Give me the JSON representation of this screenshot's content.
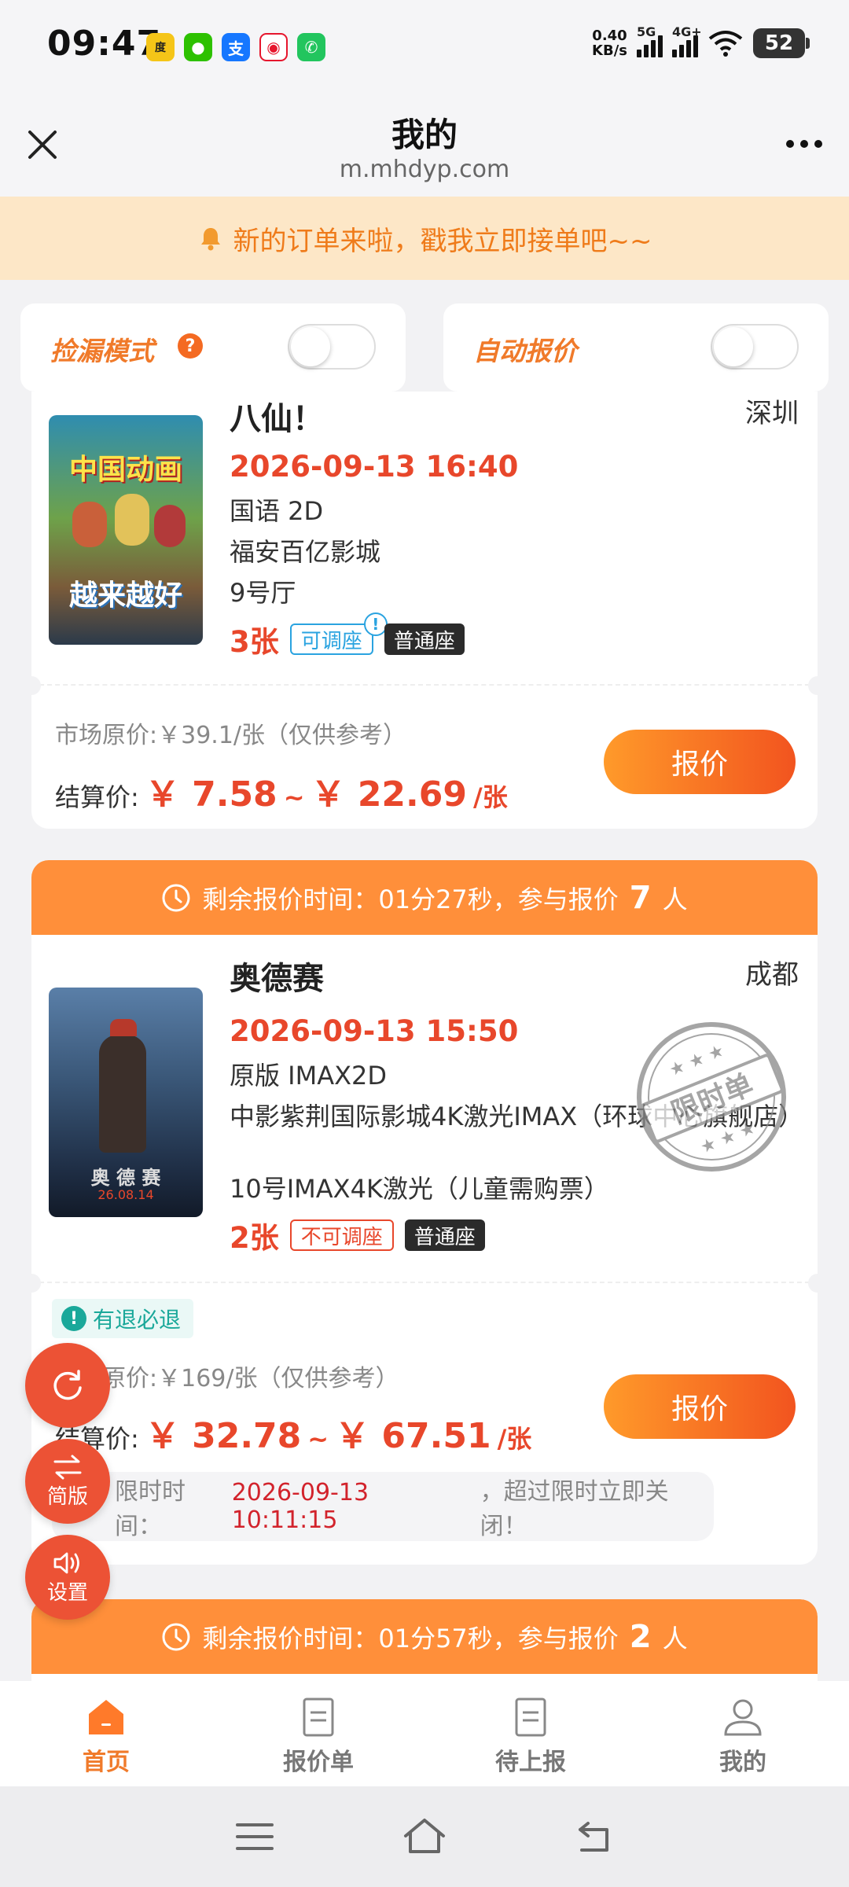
{
  "status_bar": {
    "time": "09:47",
    "net_speed_value": "0.40",
    "net_speed_unit": "KB/s",
    "signal1_label": "5G",
    "signal2_label": "4G+",
    "battery": "52",
    "app_icons": [
      "baidu-app-icon",
      "wechat-icon",
      "alipay-icon",
      "weibo-icon",
      "phone-call-icon"
    ]
  },
  "header": {
    "title": "我的",
    "url": "m.mhdyp.com"
  },
  "notice": {
    "text": "新的订单来啦，戳我立即接单吧~~"
  },
  "toggles": [
    {
      "label": "捡漏模式",
      "on": false
    },
    {
      "label": "自动报价",
      "on": false
    }
  ],
  "orders": [
    {
      "movie": "八仙！",
      "city": "深圳",
      "datetime": "2026-09-13 16:40",
      "format": "国语 2D",
      "cinema": "福安百亿影城",
      "hall": "9号厅",
      "count": "3张",
      "tag1": "可调座",
      "tag2": "普通座",
      "market_price": "市场原价:￥39.1/张（仅供参考）",
      "settle_label": "结算价:",
      "price_low": "￥ 7.58",
      "price_sep": "~",
      "price_high": "￥ 22.69",
      "price_unit": "/张",
      "quote_btn": "报价",
      "poster_text1": "中国动画",
      "poster_text2": "越来越好"
    },
    {
      "countdown_prefix": "剩余报价时间：01分27秒，参与报价",
      "countdown_count": "7",
      "countdown_suffix": "人",
      "movie": "奥德赛",
      "city": "成都",
      "datetime": "2026-09-13 15:50",
      "format": "原版 IMAX2D",
      "cinema": "中影紫荆国际影城4K激光IMAX（环球中心旗舰店）",
      "hall": "10号IMAX4K激光（儿童需购票）",
      "count": "2张",
      "tag1": "不可调座",
      "tag2": "普通座",
      "refund_badge": "有退必退",
      "market_price": "市场原价:￥169/张（仅供参考）",
      "settle_label": "结算价:",
      "price_low": "￥ 32.78",
      "price_sep": "~",
      "price_high": "￥ 67.51",
      "price_unit": "/张",
      "quote_btn": "报价",
      "stamp_text": "限时单",
      "poster_text": "奥 德 赛",
      "poster_date": "26.08.14",
      "limit_label": "限时时间：",
      "limit_time": "2026-09-13 10:11:15",
      "limit_suffix": "，超过限时立即关闭！"
    },
    {
      "countdown_prefix": "剩余报价时间：01分57秒，参与报价",
      "countdown_count": "2",
      "countdown_suffix": "人"
    }
  ],
  "fabs": [
    {
      "label": "",
      "icon": "refresh-icon"
    },
    {
      "label": "简版",
      "icon": "swap-icon"
    },
    {
      "label": "设置",
      "icon": "speaker-icon"
    }
  ],
  "tabs": [
    {
      "label": "首页",
      "active": true
    },
    {
      "label": "报价单",
      "active": false
    },
    {
      "label": "待上报",
      "active": false
    },
    {
      "label": "我的",
      "active": false
    }
  ],
  "colors": {
    "accent_orange": "#ff8f3a",
    "price_red": "#e8472b",
    "notice_bg": "#fde7c7",
    "tag_blue": "#2aa3e0",
    "refund_teal": "#1aa89a"
  }
}
